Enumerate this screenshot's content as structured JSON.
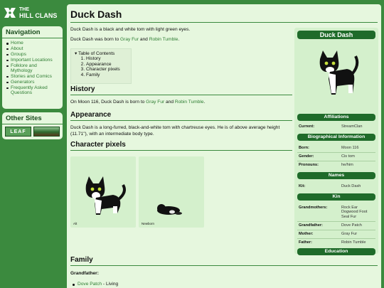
{
  "site": {
    "title_line1": "THE",
    "title_line2": "HILL CLANS"
  },
  "nav": {
    "heading": "Navigation",
    "items": [
      "Home",
      "About",
      "Groups",
      "Important Locations",
      "Folklore and Mythology",
      "Stories and Comics",
      "Generators",
      "Frequently Asked Questions"
    ]
  },
  "other_sites": {
    "heading": "Other Sites",
    "leaf_label": "LEAF",
    "second_site": "forest banner"
  },
  "page": {
    "title": "Duck Dash",
    "intro1": "Duck Dash is a black and white tom with light green eyes.",
    "intro2_pre": "Duck Dash was born to ",
    "parent1": "Gray Fur",
    "and": " and ",
    "parent2": "Robin Tumble",
    "period": ".",
    "toc": {
      "title": "Table of Contents",
      "items": [
        "History",
        "Appearance",
        "Character pixels",
        "Family"
      ]
    },
    "history_heading": "History",
    "history_pre": "On Moon 116, Duck Dash is born to ",
    "appearance_heading": "Appearance",
    "appearance_text1": "Duck Dash is a long-furred, black-and-white tom with chartreuse eyes. He is of above average height",
    "appearance_text2": "(11.71\"), with an intermediate body type.",
    "pixels_heading": "Character pixels",
    "pixel_captions": [
      "Alt",
      "Newborn"
    ],
    "family_heading": "Family",
    "family_grandfather_label": "Grandfather:",
    "family_grandfather_name": "Dove Patch",
    "family_grandfather_status": " - Living"
  },
  "infobox": {
    "name": "Duck Dash",
    "affiliations_heading": "Affiliations",
    "current_label": "Current:",
    "current_value": "StreamClan",
    "bio_heading": "Biographical Information",
    "born_label": "Born:",
    "born_value": "Moon 116",
    "gender_label": "Gender:",
    "gender_value": "Cis tom",
    "pronouns_label": "Pronouns:",
    "pronouns_value": "he/him",
    "names_heading": "Names",
    "kit_label": "Kit:",
    "kit_value": "Duck Dash",
    "kin_heading": "Kin",
    "grandmothers_label": "Grandmothers:",
    "grandmothers_values": [
      "Rock Ear",
      "Dogwood Foot",
      "Seal Fur"
    ],
    "grandfather_label": "Grandfather:",
    "grandfather_value": "Dove Patch",
    "mother_label": "Mother:",
    "mother_value": "Gray Fur",
    "father_label": "Father:",
    "father_value": "Robin Tumble",
    "education_heading": "Education"
  },
  "colors": {
    "sidebar": "#3b8a3e",
    "panel": "#e6f7de",
    "bar": "#1f6b2a",
    "link": "#2e7d32"
  }
}
